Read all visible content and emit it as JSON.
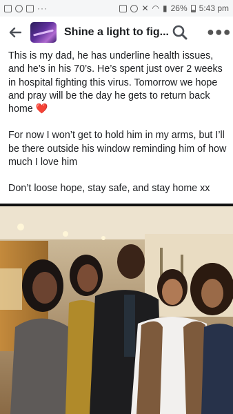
{
  "status_bar": {
    "battery": "26%",
    "time": "5:43 pm"
  },
  "header": {
    "title": "Shine a light to fig..."
  },
  "post": {
    "paragraphs": [
      "This is my dad, he has underline health issues, and he’s in his 70’s. He’s spent just over 2 weeks in hospital fighting this virus. Tomorrow we hope and pray will be the day he gets to return back home",
      "For now I won’t get to hold him in my arms, but I’ll be there outside his window reminding him of how much I love him",
      "Don’t loose hope, stay safe, and stay home xx"
    ],
    "heart_emoji": "❤️"
  },
  "icons": {
    "back": "arrow-left-icon",
    "search": "search-icon",
    "more": "more-dots-icon"
  },
  "colors": {
    "heart": "#e0245e",
    "status_bar_bg": "#f5f6f7"
  }
}
